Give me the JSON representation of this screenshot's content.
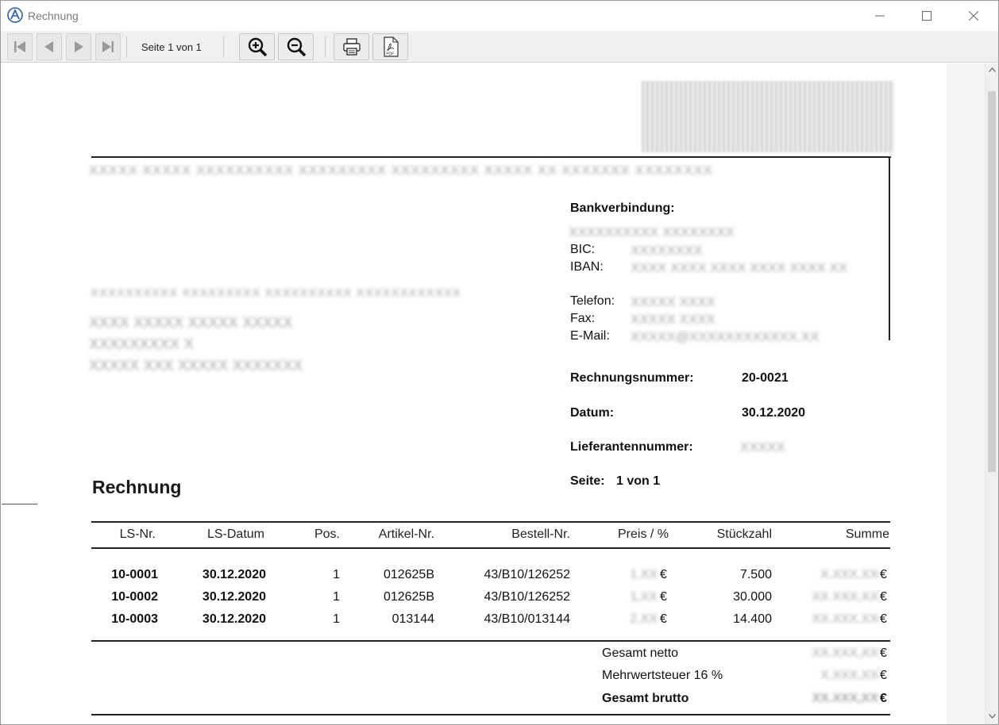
{
  "window": {
    "title": "Rechnung",
    "minimize": "—",
    "maximize": "☐",
    "close": "✕"
  },
  "toolbar": {
    "page_text": "Seite  1  von  1",
    "icons": [
      "first-page-icon",
      "previous-page-icon",
      "next-page-icon",
      "last-page-icon",
      "zoom-in-icon",
      "zoom-out-icon",
      "print-icon",
      "pdf-icon"
    ],
    "pdf_label": "PDF"
  },
  "document": {
    "company_logo_text": "",
    "sender_line": "XXXXX XXXXX XXXXXXXXXX XXXXXXXXX XXXXXXXXX XXXXX XX XXXXXXX XXXXXXXX",
    "recipient_small_line": "XXXXXXXXXX XXXXXXXXX XXXXXXXXXX XXXXXXXXXXXX",
    "recipient": {
      "name": "XXXX XXXXX XXXXX XXXXX",
      "street": "XXXXXXXXX X",
      "city": "XXXXX XXX XXXXX XXXXXXX"
    },
    "bank": {
      "heading": "Bankverbindung:",
      "bank_name": "XXXXXXXXXX XXXXXXXX",
      "bic_label": "BIC:",
      "bic_value": "XXXXXXXX",
      "iban_label": "IBAN:",
      "iban_value": "XXXX XXXX XXXX XXXX XXXX XX"
    },
    "contact": {
      "telefon_label": "Telefon:",
      "telefon_value": "XXXXX XXXX",
      "fax_label": "Fax:",
      "fax_value": "XXXXX XXXX",
      "email_label": "E-Mail:",
      "email_value": "XXXXX@XXXXXXXXXXXX.XX"
    },
    "meta": {
      "rechnungsnummer_label": "Rechnungsnummer:",
      "rechnungsnummer_value": "20-0021",
      "datum_label": "Datum:",
      "datum_value": "30.12.2020",
      "lieferantennummer_label": "Lieferantennummer:",
      "lieferantennummer_value": "XXXXX",
      "seite_label": "Seite:",
      "seite_value": "1 von 1"
    },
    "heading": "Rechnung",
    "table": {
      "headers": [
        "LS-Nr.",
        "LS-Datum",
        "Pos.",
        "Artikel-Nr.",
        "Bestell-Nr.",
        "Preis / %",
        "Stückzahl",
        "Summe"
      ],
      "rows": [
        {
          "ls_nr": "10-0001",
          "ls_datum": "30.12.2020",
          "pos": "1",
          "artikel": "012625B",
          "bestell": "43/B10/126252",
          "preis": "1,XX",
          "stueck": "7.500",
          "summe": "X.XXX,XX"
        },
        {
          "ls_nr": "10-0002",
          "ls_datum": "30.12.2020",
          "pos": "1",
          "artikel": "012625B",
          "bestell": "43/B10/126252",
          "preis": "1,XX",
          "stueck": "30.000",
          "summe": "XX.XXX,XX"
        },
        {
          "ls_nr": "10-0003",
          "ls_datum": "30.12.2020",
          "pos": "1",
          "artikel": "013144",
          "bestell": "43/B10/013144",
          "preis": "2,XX",
          "stueck": "14.400",
          "summe": "XX.XXX,XX"
        }
      ],
      "currency": "€"
    },
    "totals": {
      "netto_label": "Gesamt netto",
      "netto_value": "XX.XXX,XX",
      "mwst_label": "Mehrwertsteuer 16 %",
      "mwst_value": "X.XXX,XX",
      "brutto_label": "Gesamt brutto",
      "brutto_value": "XX.XXX,XX"
    }
  }
}
